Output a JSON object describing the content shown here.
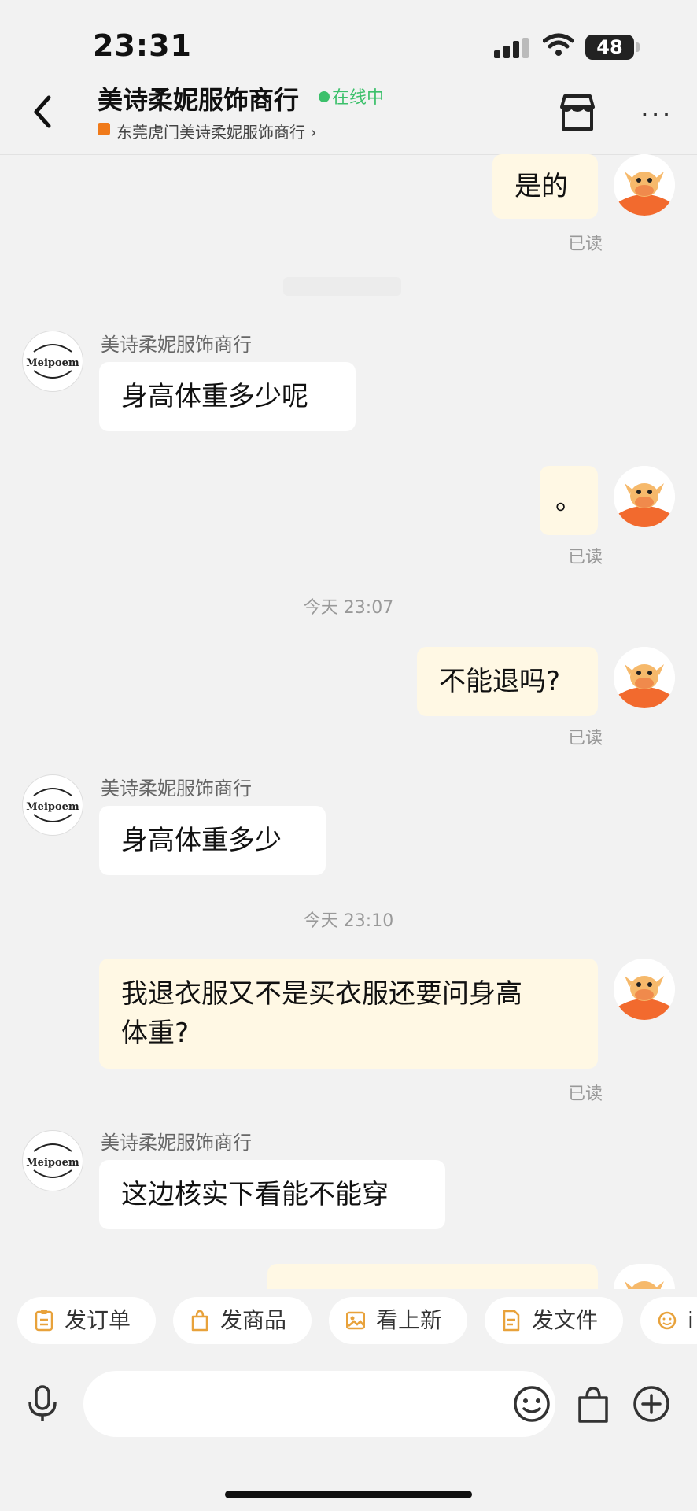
{
  "status_bar": {
    "time": "23:31",
    "battery": "48"
  },
  "header": {
    "shop_name": "美诗柔妮服饰商行",
    "online_status": "在线中",
    "shop_subtitle": "东莞虎门美诗柔妮服饰商行 ›",
    "more": "···"
  },
  "chat": {
    "messages": [
      {
        "side": "right",
        "text": "是的",
        "read": "已读"
      },
      {
        "side": "left",
        "sender": "美诗柔妮服饰商行",
        "text": "身高体重多少呢"
      },
      {
        "side": "right",
        "text": "。",
        "read": "已读"
      },
      {
        "timestamp": "今天 23:07"
      },
      {
        "side": "right",
        "text": "不能退吗?",
        "read": "已读"
      },
      {
        "side": "left",
        "sender": "美诗柔妮服饰商行",
        "text": "身高体重多少"
      },
      {
        "timestamp": "今天 23:10"
      },
      {
        "side": "right",
        "text_line1": "我退衣服又不是买衣服还要问身高",
        "text_line2": "体重?",
        "read": "已读"
      },
      {
        "side": "left",
        "sender": "美诗柔妮服饰商行",
        "text": "这边核实下看能不能穿"
      }
    ],
    "avatar_left_text": "Meipoem"
  },
  "quick_actions": [
    {
      "label": "发订单",
      "icon": "order-icon"
    },
    {
      "label": "发商品",
      "icon": "shopping-bag-icon"
    },
    {
      "label": "看上新",
      "icon": "image-icon"
    },
    {
      "label": "发文件",
      "icon": "file-icon"
    },
    {
      "label": "i",
      "icon": "emoji-icon"
    }
  ],
  "input": {
    "placeholder": ""
  },
  "colors": {
    "online": "#3cc06b",
    "bubble_self": "#fff8e4",
    "bubble_other": "#ffffff",
    "background": "#f2f2f2"
  }
}
